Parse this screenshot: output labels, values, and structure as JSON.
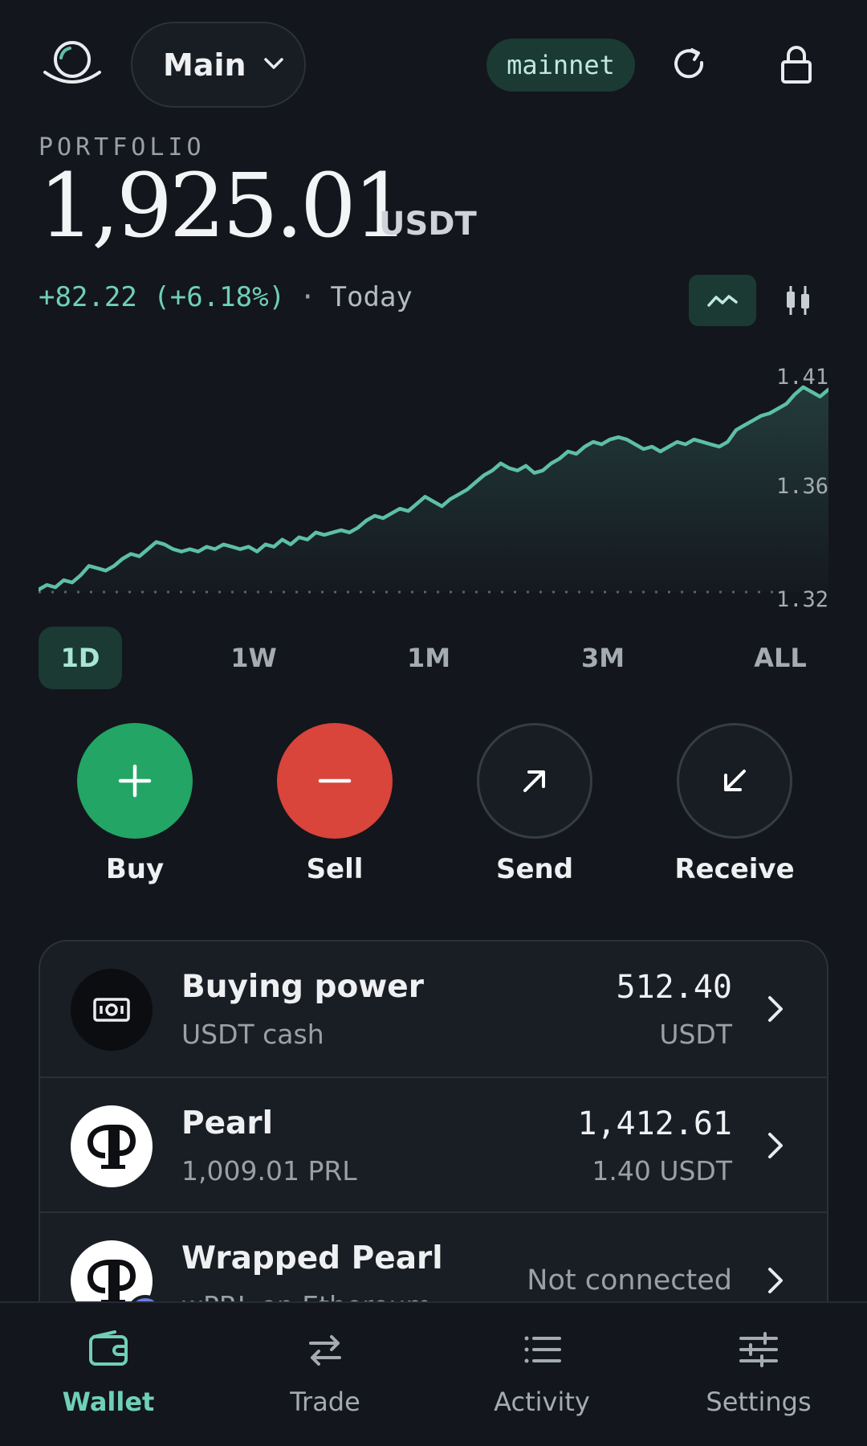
{
  "header": {
    "account_label": "Main",
    "network": "mainnet"
  },
  "portfolio": {
    "label": "PORTFOLIO",
    "balance": "1,925.01",
    "unit": "USDT",
    "change": "+82.22 (+6.18%)",
    "separator": "·",
    "period": "Today"
  },
  "chart_data": {
    "type": "area",
    "y_ticks": [
      "1.41",
      "1.36",
      "1.32"
    ],
    "ylim": [
      1.32,
      1.41
    ],
    "values": [
      1.321,
      1.323,
      1.322,
      1.325,
      1.324,
      1.327,
      1.331,
      1.33,
      1.329,
      1.331,
      1.334,
      1.336,
      1.335,
      1.338,
      1.341,
      1.34,
      1.338,
      1.337,
      1.338,
      1.337,
      1.339,
      1.338,
      1.34,
      1.339,
      1.338,
      1.339,
      1.337,
      1.34,
      1.339,
      1.342,
      1.34,
      1.343,
      1.342,
      1.345,
      1.344,
      1.345,
      1.346,
      1.345,
      1.347,
      1.35,
      1.352,
      1.351,
      1.353,
      1.355,
      1.354,
      1.357,
      1.36,
      1.358,
      1.356,
      1.359,
      1.361,
      1.363,
      1.366,
      1.369,
      1.371,
      1.374,
      1.372,
      1.371,
      1.373,
      1.37,
      1.371,
      1.374,
      1.376,
      1.379,
      1.378,
      1.381,
      1.383,
      1.382,
      1.384,
      1.385,
      1.384,
      1.382,
      1.38,
      1.381,
      1.379,
      1.381,
      1.383,
      1.382,
      1.384,
      1.383,
      1.382,
      1.381,
      1.383,
      1.388,
      1.39,
      1.392,
      1.394,
      1.395,
      1.397,
      1.399,
      1.403,
      1.406,
      1.404,
      1.402,
      1.405
    ],
    "grid": false,
    "colors": {
      "line": "#5ebfa8",
      "baseline": "#5a6068"
    }
  },
  "ranges": [
    "1D",
    "1W",
    "1M",
    "3M",
    "ALL"
  ],
  "active_range": "1D",
  "actions": {
    "buy": "Buy",
    "sell": "Sell",
    "send": "Send",
    "receive": "Receive"
  },
  "assets": [
    {
      "name": "Buying power",
      "sub": "USDT cash",
      "value": "512.40",
      "value_sub": "USDT",
      "icon": "cash-icon"
    },
    {
      "name": "Pearl",
      "sub": "1,009.01 PRL",
      "value": "1,412.61",
      "value_sub": "1.40 USDT",
      "icon": "pearl-logo"
    },
    {
      "name": "Wrapped Pearl",
      "sub": "wPRL on Ethereum",
      "status": "Not connected",
      "icon": "pearl-logo"
    }
  ],
  "nav": {
    "wallet": "Wallet",
    "trade": "Trade",
    "activity": "Activity",
    "settings": "Settings"
  },
  "colors": {
    "accent": "#6fd0b7",
    "buy": "#22a565",
    "sell": "#d9443b",
    "background": "#13161c"
  }
}
